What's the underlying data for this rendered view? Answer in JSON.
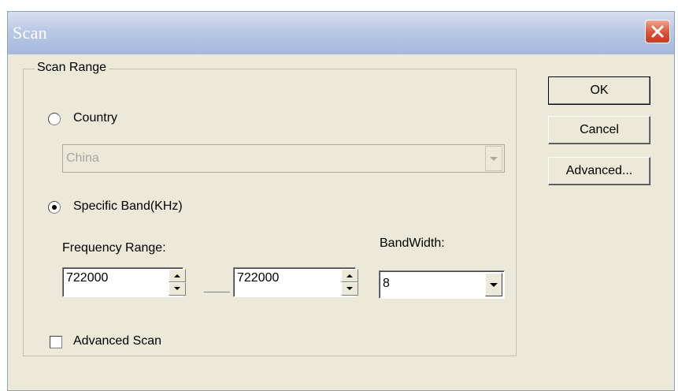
{
  "window": {
    "title": "Scan"
  },
  "scan_range": {
    "legend": "Scan Range",
    "country_radio": {
      "label": "Country",
      "checked": false
    },
    "country_select": {
      "value": "China",
      "disabled": true
    },
    "specific_band_radio": {
      "label": "Specific Band(KHz)",
      "checked": true
    },
    "frequency_range_label": "Frequency Range:",
    "frequency_from": "722000",
    "frequency_to": "722000",
    "bandwidth_label": "BandWidth:",
    "bandwidth_select": {
      "value": "8"
    },
    "advanced_scan_checkbox": {
      "label": "Advanced Scan",
      "checked": false
    }
  },
  "buttons": {
    "ok": "OK",
    "cancel": "Cancel",
    "advanced": "Advanced..."
  },
  "icons": {
    "close": "close-icon",
    "dropdown": "chevron-down-icon",
    "spin_up": "arrow-up-icon",
    "spin_down": "arrow-down-icon"
  },
  "colors": {
    "dialog_bg": "#ece9d8",
    "titlebar": "#a6b9dd",
    "close_button": "#d8543a"
  }
}
